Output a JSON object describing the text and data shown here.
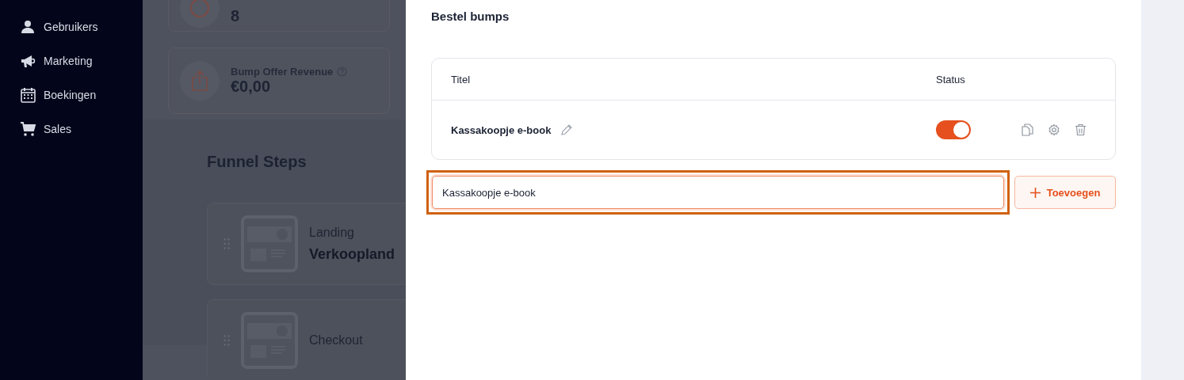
{
  "sidebar": {
    "items": [
      {
        "label": "Gebruikers"
      },
      {
        "label": "Marketing"
      },
      {
        "label": "Boekingen"
      },
      {
        "label": "Sales"
      }
    ]
  },
  "dashboard": {
    "stat_cards": [
      {
        "value": "8"
      },
      {
        "title": "Bump Offer Revenue",
        "value": "€0,00"
      }
    ],
    "funnel_steps": {
      "title": "Funnel Steps",
      "steps": [
        {
          "type": "Landing",
          "name": "Verkoopland"
        },
        {
          "type": "Checkout"
        }
      ]
    }
  },
  "drawer": {
    "title": "Bestel bumps",
    "table": {
      "columns": [
        "Titel",
        "Status"
      ],
      "rows": [
        {
          "title": "Kassakoopje e-book",
          "on": true
        }
      ]
    },
    "new_item": {
      "value": "Kassakoopje e-book",
      "highlighted": true
    },
    "add_button": {
      "label": "Toevoegen"
    }
  }
}
